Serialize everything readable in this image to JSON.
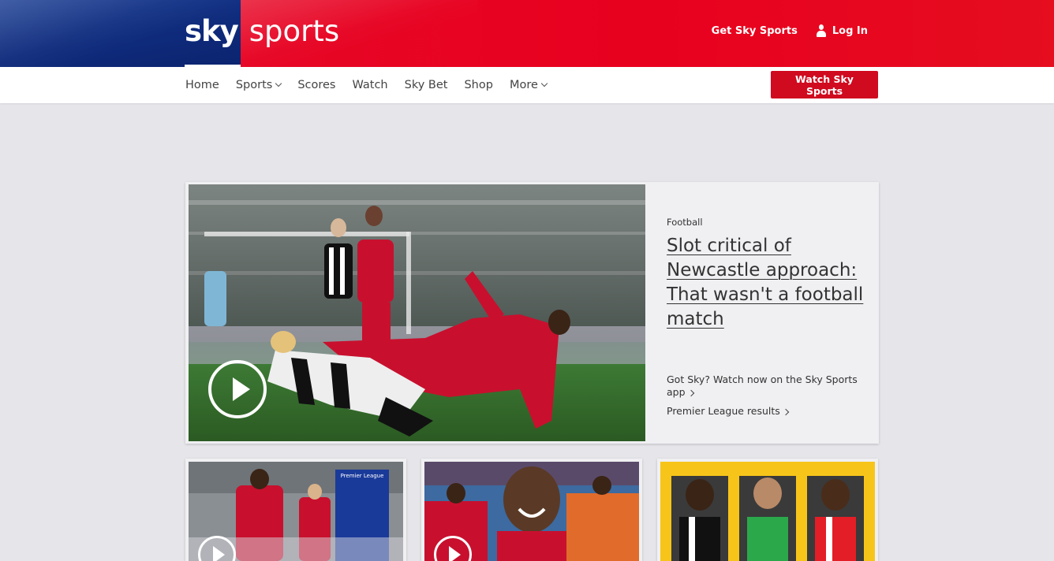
{
  "header": {
    "logo_sky": "sky",
    "logo_sports": "sports",
    "get_sky_sports": "Get Sky Sports",
    "log_in": "Log In"
  },
  "nav": {
    "items": [
      {
        "label": "Home"
      },
      {
        "label": "Sports",
        "dropdown": true
      },
      {
        "label": "Scores"
      },
      {
        "label": "Watch"
      },
      {
        "label": "Sky Bet"
      },
      {
        "label": "Shop"
      },
      {
        "label": "More",
        "dropdown": true
      }
    ],
    "watch_button": "Watch Sky Sports"
  },
  "hero": {
    "category": "Football",
    "headline": "Slot critical of Newcastle approach: That wasn't a football match",
    "links": [
      "Got Sky? Watch now on the Sky Sports app",
      "Premier League results"
    ]
  },
  "cards": [
    {
      "badge_text": "Premier League"
    },
    {},
    {}
  ],
  "colors": {
    "brand_red": "#e8001f",
    "brand_blue": "#0f2b7c",
    "button_red": "#d00a1f"
  },
  "icons": {
    "login": "user-icon",
    "video": "play-icon",
    "dropdown": "chevron-down-icon",
    "link": "chevron-right-icon"
  }
}
